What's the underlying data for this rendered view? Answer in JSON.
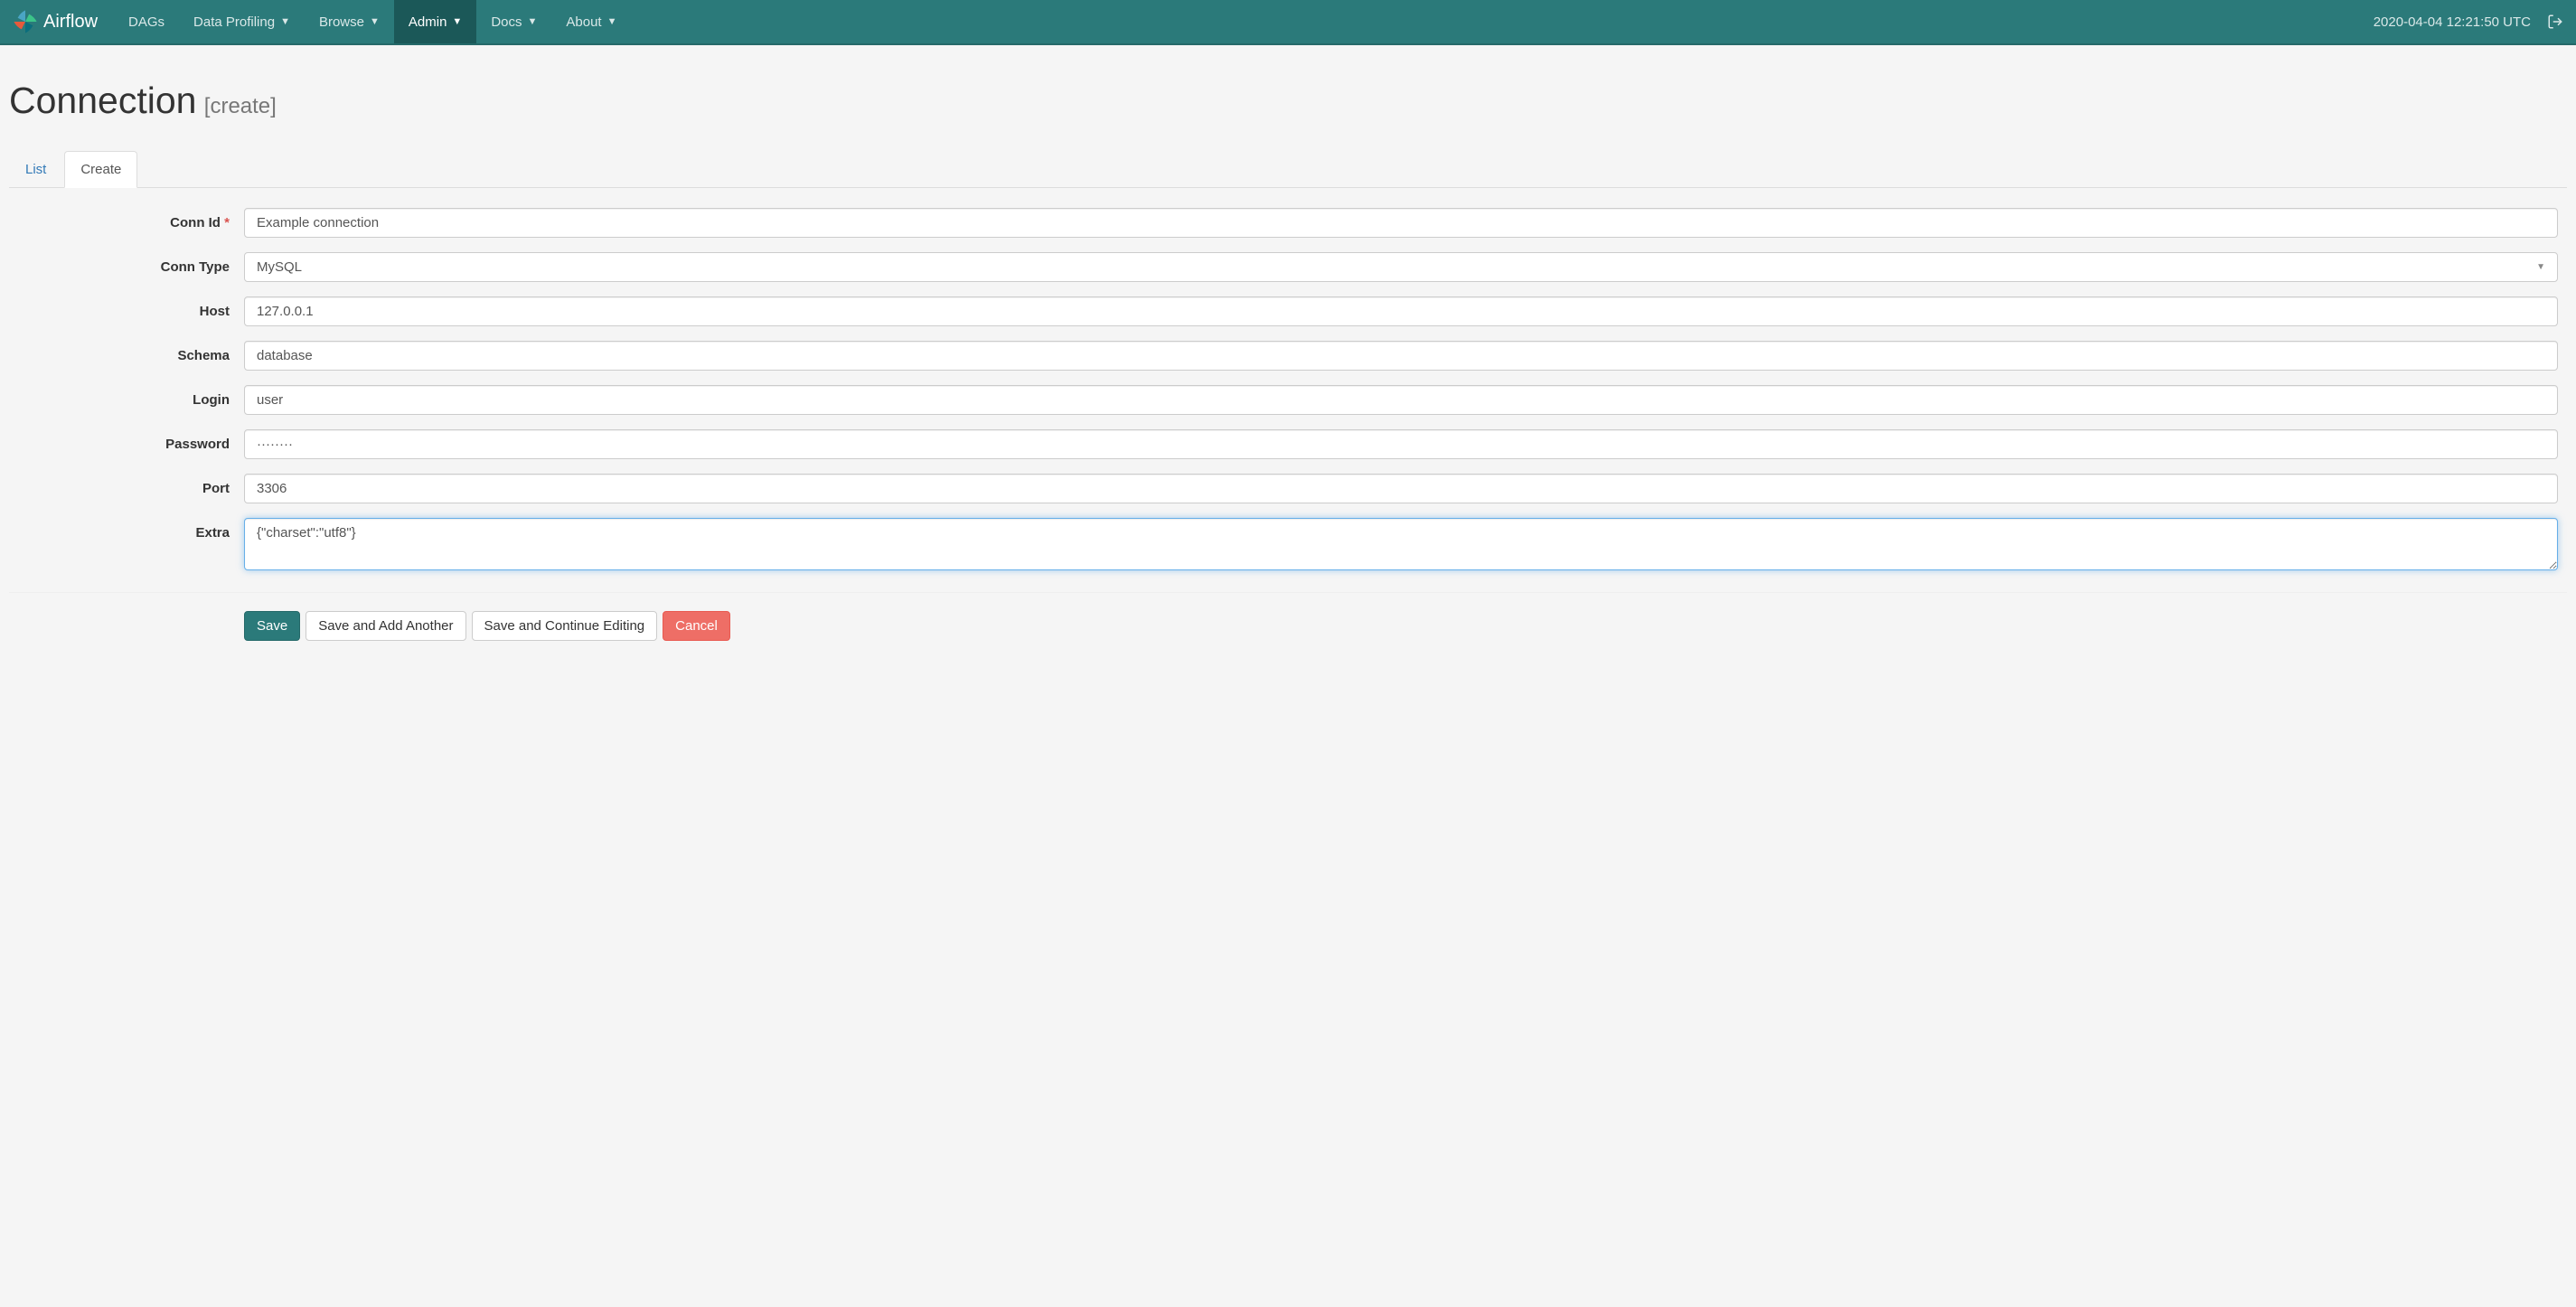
{
  "navbar": {
    "brand": "Airflow",
    "items": [
      {
        "label": "DAGs",
        "dropdown": false,
        "active": false
      },
      {
        "label": "Data Profiling",
        "dropdown": true,
        "active": false
      },
      {
        "label": "Browse",
        "dropdown": true,
        "active": false
      },
      {
        "label": "Admin",
        "dropdown": true,
        "active": true
      },
      {
        "label": "Docs",
        "dropdown": true,
        "active": false
      },
      {
        "label": "About",
        "dropdown": true,
        "active": false
      }
    ],
    "timestamp": "2020-04-04 12:21:50 UTC"
  },
  "page": {
    "title": "Connection",
    "subtitle": "[create]"
  },
  "tabs": [
    {
      "label": "List",
      "active": false
    },
    {
      "label": "Create",
      "active": true
    }
  ],
  "form": {
    "conn_id": {
      "label": "Conn Id",
      "required": true,
      "value": "Example connection"
    },
    "conn_type": {
      "label": "Conn Type",
      "value": "MySQL"
    },
    "host": {
      "label": "Host",
      "value": "127.0.0.1"
    },
    "schema": {
      "label": "Schema",
      "value": "database"
    },
    "login": {
      "label": "Login",
      "value": "user"
    },
    "password": {
      "label": "Password",
      "value": "········"
    },
    "port": {
      "label": "Port",
      "value": "3306"
    },
    "extra": {
      "label": "Extra",
      "value": "{\"charset\":\"utf8\"}"
    }
  },
  "buttons": {
    "save": "Save",
    "save_add": "Save and Add Another",
    "save_continue": "Save and Continue Editing",
    "cancel": "Cancel"
  }
}
